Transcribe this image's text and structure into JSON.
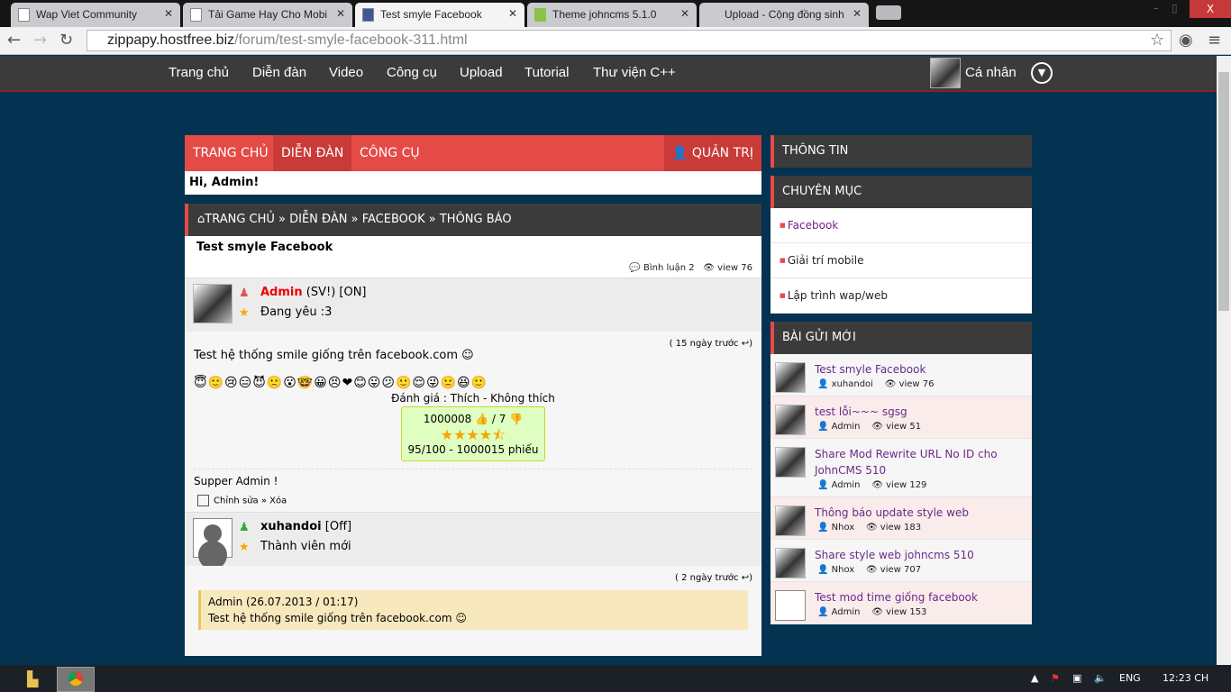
{
  "browser": {
    "tabs": [
      {
        "title": "Wap Viet Community"
      },
      {
        "title": "Tải Game Hay Cho Mobi"
      },
      {
        "title": "Test smyle Facebook",
        "active": true
      },
      {
        "title": "Theme johncms 5.1.0"
      },
      {
        "title": "Upload - Cộng đồng sinh"
      }
    ],
    "url_domain": "zippapy.hostfree.biz",
    "url_path": "/forum/test-smyle-facebook-311.html",
    "close": "X"
  },
  "sitenav": {
    "items": [
      "Trang chủ",
      "Diễn đàn",
      "Video",
      "Công cụ",
      "Upload",
      "Tutorial",
      "Thư viện C++"
    ],
    "profile": "Cá nhân"
  },
  "menu": {
    "home": "TRANG CHỦ",
    "forum": "DIỄN ĐÀN",
    "tools": "CÔNG CỤ",
    "admin": "QUẢN TRỊ",
    "greeting": "Hi, Admin!"
  },
  "breadcrumb": "TRANG CHỦ » DIỄN ĐÀN » FACEBOOK » THÔNG BÁO",
  "topic": {
    "title": "Test smyle Facebook",
    "comments": "Bình luận 2",
    "views": "view 76"
  },
  "post1": {
    "author": "Admin",
    "tags": "(SV!) [ON]",
    "status": "Đang yêu :3",
    "time": "( 15 ngày trước ↩)",
    "text": "Test hệ thống smile giống trên facebook.com ☺",
    "smiles": "😇🙂😢😑😈🙁😮🤓😀😣❤😊😛😕🙂😌😜🙁😆🙂",
    "rating_label": "Đánh giá : Thích - Không thích",
    "likes": "1000008 👍  / 7 👎",
    "stars": "★★★★⯪",
    "score": "95/100 - 1000015 phiếu",
    "signature": "Supper Admin !",
    "edit": "Chỉnh sửa",
    "sep": " » ",
    "delete": "Xóa"
  },
  "post2": {
    "author": "xuhandoi",
    "tags": "[Off]",
    "status": "Thành viên mới",
    "time": "( 2 ngày trước ↩)",
    "quote_head": "Admin (26.07.2013 / 01:17)",
    "quote_text": "Test hệ thống smile giống trên facebook.com ☺"
  },
  "sidebar": {
    "info": "THÔNG TIN",
    "categories_title": "CHUYÊN MỤC",
    "categories": [
      "Facebook",
      "Giải trí mobile",
      "Lập trình wap/web"
    ],
    "new_title": "BÀI GỬI MỚI",
    "posts": [
      {
        "title": "Test smyle Facebook",
        "user": "xuhandoi",
        "views": "view 76"
      },
      {
        "title": "test lỗi~~~ sgsg",
        "user": "Admin",
        "views": "view 51"
      },
      {
        "title": "Share Mod Rewrite URL No ID cho JohnCMS 510",
        "user": "Admin",
        "views": "view 129"
      },
      {
        "title": "Thông báo update style web",
        "user": "Nhox",
        "views": "view 183"
      },
      {
        "title": "Share style web johncms 510",
        "user": "Nhox",
        "views": "view 707"
      },
      {
        "title": "Test mod time giống facebook",
        "user": "Admin",
        "views": "view 153"
      }
    ]
  },
  "taskbar": {
    "lang": "ENG",
    "clock": "12:23 CH"
  }
}
